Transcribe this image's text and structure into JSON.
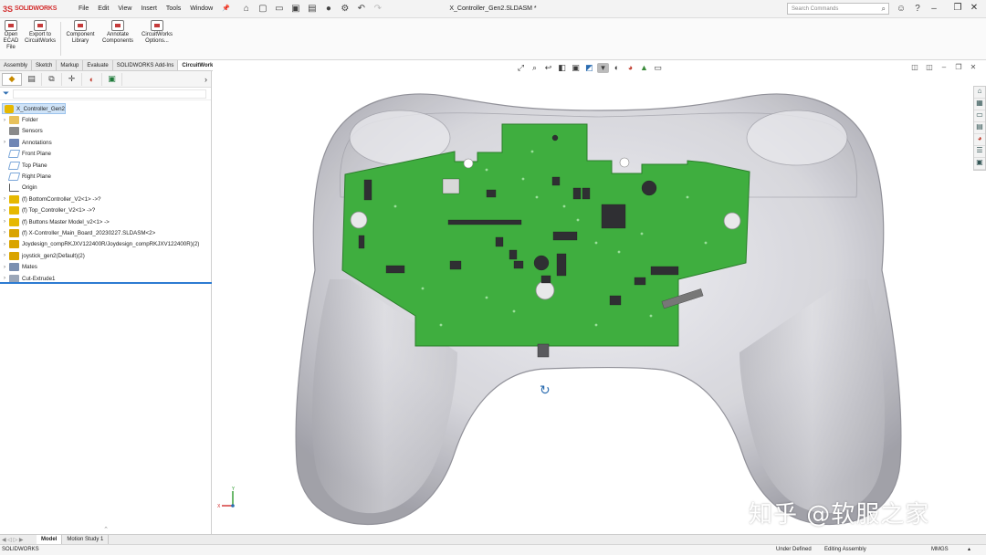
{
  "app": {
    "name": "SOLIDWORKS",
    "logo_prefix": "3S",
    "document_title": "X_Controller_Gen2.SLDASM *"
  },
  "menu": [
    "File",
    "Edit",
    "View",
    "Insert",
    "Tools",
    "Window"
  ],
  "search": {
    "placeholder": "Search Commands"
  },
  "ribbon": {
    "buttons": [
      {
        "label": "Open ECAD File",
        "icon": "open-ecad-icon"
      },
      {
        "label": "Export to CircuitWorks",
        "icon": "export-circuitworks-icon"
      },
      {
        "label": "Component Library",
        "icon": "component-library-icon"
      },
      {
        "label": "Annotate Components",
        "icon": "annotate-components-icon"
      },
      {
        "label": "CircuitWorks Options...",
        "icon": "circuitworks-options-icon"
      }
    ]
  },
  "command_tabs": [
    {
      "label": "Assembly",
      "active": false
    },
    {
      "label": "Sketch",
      "active": false
    },
    {
      "label": "Markup",
      "active": false
    },
    {
      "label": "Evaluate",
      "active": false
    },
    {
      "label": "SOLIDWORKS Add-Ins",
      "active": false
    },
    {
      "label": "CircuitWorks",
      "active": true
    }
  ],
  "feature_tree": {
    "root": "X_Controller_Gen2",
    "items": [
      {
        "label": "Folder",
        "icon": "folder-icon",
        "expandable": true
      },
      {
        "label": "Sensors",
        "icon": "sensors-icon",
        "expandable": false
      },
      {
        "label": "Annotations",
        "icon": "annotations-icon",
        "expandable": true
      },
      {
        "label": "Front Plane",
        "icon": "plane-icon",
        "expandable": false
      },
      {
        "label": "Top Plane",
        "icon": "plane-icon",
        "expandable": false
      },
      {
        "label": "Right Plane",
        "icon": "plane-icon",
        "expandable": false
      },
      {
        "label": "Origin",
        "icon": "origin-icon",
        "expandable": false
      },
      {
        "label": "(f) BottomController_V2<1> ->?",
        "icon": "part-icon",
        "expandable": true
      },
      {
        "label": "(f) Top_Controller_V2<1> ->?",
        "icon": "part-icon",
        "expandable": true
      },
      {
        "label": "(f) Buttons Master Model_v2<1> ->",
        "icon": "part-icon",
        "expandable": true
      },
      {
        "label": "(f) X-Controller_Main_Board_20230227.SLDASM<2>",
        "icon": "subassembly-icon",
        "expandable": true
      },
      {
        "label": "Joydesign_compRKJXV122400R/Joydesign_compRKJXV122400R)(2)",
        "icon": "subassembly-icon",
        "expandable": true
      },
      {
        "label": "joystick_gen2(Default)(2)",
        "icon": "subassembly-icon",
        "expandable": true
      },
      {
        "label": "Mates",
        "icon": "mates-icon",
        "expandable": true
      },
      {
        "label": "Cut-Extrude1",
        "icon": "cut-extrude-icon",
        "expandable": true
      }
    ]
  },
  "bottom_tabs": [
    {
      "label": "Model",
      "active": true
    },
    {
      "label": "Motion Study 1",
      "active": false
    }
  ],
  "status_bar": {
    "app_name": "SOLIDWORKS",
    "definition": "Under Defined",
    "mode": "Editing Assembly",
    "units": "MMGS"
  },
  "watermark": "知乎 @软服之家",
  "colors": {
    "pcb_green": "#3fae3f",
    "shell_gray": "#c8c8cc",
    "brand_red": "#d32f2f",
    "selection_blue": "#2d7bd2"
  }
}
